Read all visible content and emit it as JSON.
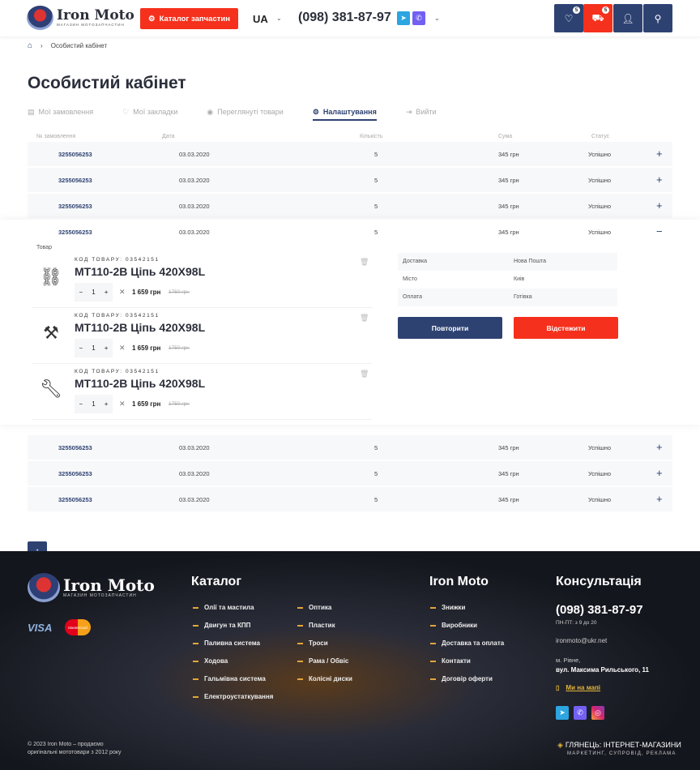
{
  "header": {
    "logo_title": "Iron Moto",
    "logo_subtitle": "МАГАЗИН МОТОЗАПЧАСТИН",
    "catalog_button": "Каталог запчастин",
    "lang": "UA",
    "phone": "(098) 381-87-97",
    "wishlist_count": "5",
    "cart_count": "5"
  },
  "breadcrumb": {
    "current": "Особистий кабінет"
  },
  "page_title": "Особистий кабінет",
  "tabs": [
    {
      "label": "Мої замовлення",
      "icon": "box-icon"
    },
    {
      "label": "Мої закладки",
      "icon": "heart-icon"
    },
    {
      "label": "Переглянуті товари",
      "icon": "eye-icon"
    },
    {
      "label": "Налаштування",
      "icon": "gear-icon",
      "active": true
    },
    {
      "label": "Вийти",
      "icon": "logout-icon"
    }
  ],
  "table": {
    "columns": [
      "№ замовлення",
      "Дата",
      "Кількість",
      "Сума",
      "Статус"
    ],
    "rows": [
      {
        "no": "3255056253",
        "date": "03.03.2020",
        "qty": "5",
        "sum": "345 грн",
        "status": "Успішно",
        "toggle": "+"
      },
      {
        "no": "3255056253",
        "date": "03.03.2020",
        "qty": "5",
        "sum": "345 грн",
        "status": "Успішно",
        "toggle": "+"
      },
      {
        "no": "3255056253",
        "date": "03.03.2020",
        "qty": "5",
        "sum": "345 грн",
        "status": "Успішно",
        "toggle": "+"
      },
      {
        "no": "3255056253",
        "date": "03.03.2020",
        "qty": "5",
        "sum": "345 грн",
        "status": "Успішно",
        "toggle": "−"
      },
      {
        "no": "3255056253",
        "date": "03.03.2020",
        "qty": "5",
        "sum": "345 грн",
        "status": "Успішно",
        "toggle": "+"
      },
      {
        "no": "3255056253",
        "date": "03.03.2020",
        "qty": "5",
        "sum": "345 грн",
        "status": "Успішно",
        "toggle": "+"
      },
      {
        "no": "3255056253",
        "date": "03.03.2020",
        "qty": "5",
        "sum": "345 грн",
        "status": "Успішно",
        "toggle": "+"
      }
    ]
  },
  "expanded": {
    "items_label": "Товар",
    "items": [
      {
        "code": "КОД ТОВАРУ: 03542151",
        "name": "MT110-2B Ціпь 420X98L",
        "qty": "1",
        "price": "1 659 грн",
        "old_price": "1750 грн"
      },
      {
        "code": "КОД ТОВАРУ: 03542151",
        "name": "MT110-2B Ціпь 420X98L",
        "qty": "1",
        "price": "1 659 грн",
        "old_price": "1750 грн"
      },
      {
        "code": "КОД ТОВАРУ: 03542151",
        "name": "MT110-2B Ціпь 420X98L",
        "qty": "1",
        "price": "1 659 грн",
        "old_price": "1750 грн"
      }
    ],
    "info": [
      {
        "label": "Доставка",
        "value": "Нова Пошта"
      },
      {
        "label": "Місто",
        "value": "Киів"
      },
      {
        "label": "Оплата",
        "value": "Готівка"
      }
    ],
    "repeat_button": "Повторити",
    "track_button": "Відстежити"
  },
  "footer": {
    "logo_title": "Iron Moto",
    "logo_subtitle": "МАГАЗИН МОТОЗАПЧАСТИН",
    "visa": "VISA",
    "mastercard": "MasterCard",
    "catalog_title": "Каталог",
    "catalog_col1": [
      "Олії та мастила",
      "Двигун та КПП",
      "Паливна система",
      "Ходова",
      "Гальмівна система",
      "Електроустаткування"
    ],
    "catalog_col2": [
      "Оптика",
      "Пластик",
      "Троси",
      "Рама / Обвіс",
      "Колісні диски"
    ],
    "iron_title": "Iron Moto",
    "iron_links": [
      "Знижки",
      "Виробники",
      "Доставка та оплата",
      "Контакти",
      "Договір оферти"
    ],
    "consult_title": "Консультація",
    "phone": "(098) 381-87-97",
    "hours": "ПН-ПТ: з 9 до 20",
    "email": "ironmoto@ukr.net",
    "city": "м. Рівне,",
    "street": "вул. Максима Рильського, 11",
    "map": "Ми на мапі",
    "copyright": "© 2023 Iron Moto – продаємо",
    "copyright2": "оригінальні мототовари з 2012 року",
    "dev_title": "ГЛЯНЕЦЬ: ІНТЕРНЕТ-МАГАЗИНИ",
    "dev_sub": "МАРКЕТИНГ, СУПРОВІД, РЕКЛАМА"
  },
  "colors": {
    "primary": "#2e4272",
    "accent": "#f5301c",
    "telegram": "#2ca5e0",
    "viber": "#7360f2"
  }
}
